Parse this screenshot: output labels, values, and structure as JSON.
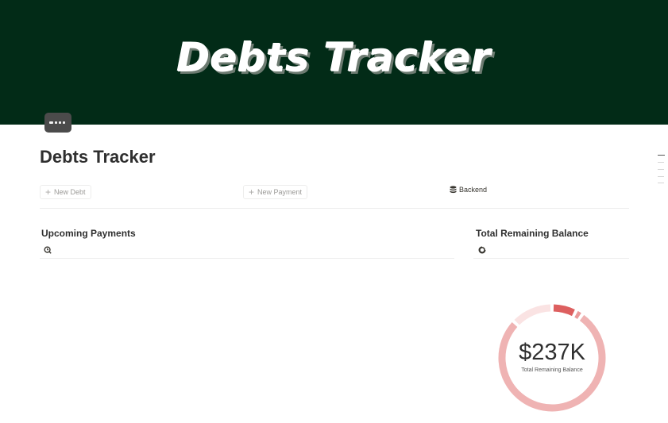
{
  "banner": {
    "title": "Debts Tracker"
  },
  "page": {
    "title": "Debts Tracker"
  },
  "toolbar": {
    "new_debt_label": "New Debt",
    "new_payment_label": "New Payment",
    "backend_label": "Backend"
  },
  "sections": {
    "upcoming_title": "Upcoming Payments",
    "balance_title": "Total Remaining Balance"
  },
  "chart_data": {
    "type": "pie",
    "center_value": "$237K",
    "center_label": "Total Remaining Balance",
    "slices": [
      {
        "value": 0.07,
        "color": "#dd5f5f"
      },
      {
        "value": 0.02,
        "color": "#ea9a9a"
      },
      {
        "value": 0.72,
        "color": "#efb3b3"
      },
      {
        "value": 0.12,
        "color": "#fae3e3"
      }
    ]
  },
  "colors": {
    "banner_bg": "#022b17",
    "accent_red": "#dd5f5f",
    "ring": "#efb3b3"
  },
  "icons": [
    "credit-card-icon",
    "plus-icon",
    "database-icon",
    "calendar-view-icon",
    "chart-view-icon"
  ]
}
